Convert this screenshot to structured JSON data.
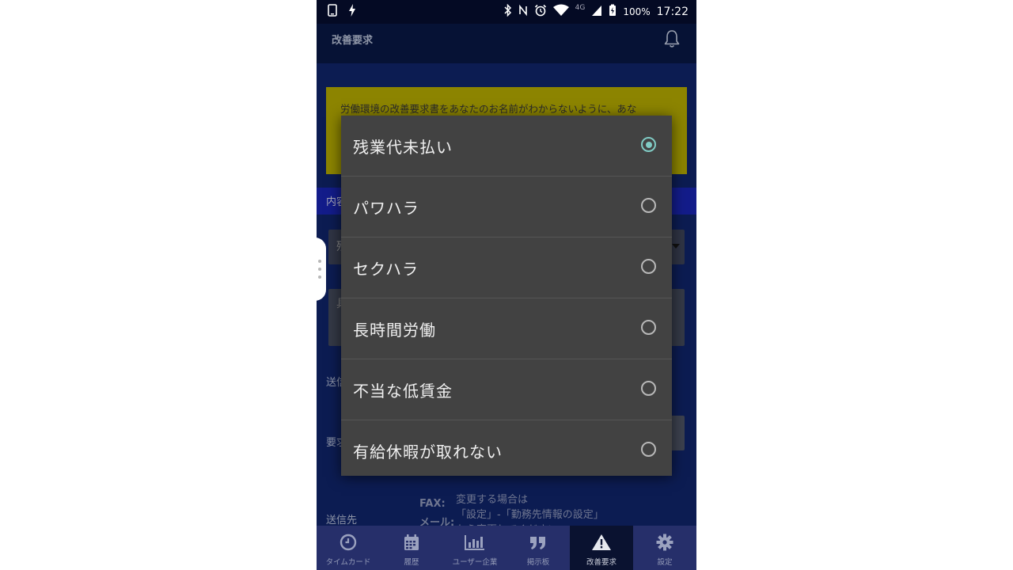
{
  "status_bar": {
    "battery": "100%",
    "time": "17:22",
    "network": "4G",
    "icons_left": [
      "phone-icon",
      "flash-icon"
    ],
    "icons_right": [
      "bluetooth-icon",
      "nfc-icon",
      "alarm-icon",
      "wifi-icon",
      "signal-icon",
      "battery-icon"
    ]
  },
  "app_bar": {
    "title": "改善要求",
    "bell_icon": "bell-icon"
  },
  "notice": {
    "text": "労働環境の改善要求書をあなたのお名前がわからないように、あな"
  },
  "form": {
    "section_label": "内容",
    "category_partial": "残",
    "detail_partial": "具",
    "send_label": "送信",
    "request_label": "要求",
    "destination_label": "送信先",
    "fax_label": "FAX:",
    "mail_label": "メール:",
    "change_note_1": "変更する場合は",
    "change_note_2": "「設定」-「勤務先情報の設定」",
    "change_note_3": "から変更してください"
  },
  "dialog": {
    "options": [
      {
        "label": "残業代未払い",
        "selected": true
      },
      {
        "label": "パワハラ",
        "selected": false
      },
      {
        "label": "セクハラ",
        "selected": false
      },
      {
        "label": "長時間労働",
        "selected": false
      },
      {
        "label": "不当な低賃金",
        "selected": false
      },
      {
        "label": "有給休暇が取れない",
        "selected": false
      }
    ]
  },
  "bottom_nav": {
    "items": [
      {
        "label": "タイムカード",
        "icon": "clock-icon",
        "active": false
      },
      {
        "label": "履歴",
        "icon": "calendar-icon",
        "active": false
      },
      {
        "label": "ユーザー企業",
        "icon": "bar-chart-icon",
        "active": false
      },
      {
        "label": "掲示板",
        "icon": "quote-icon",
        "active": false
      },
      {
        "label": "改善要求",
        "icon": "warning-icon",
        "active": true
      },
      {
        "label": "設定",
        "icon": "gear-icon",
        "active": false
      }
    ]
  },
  "colors": {
    "accent": "#80cbc4",
    "app_background": "#0c1c52",
    "notice_yellow": "#8c8400",
    "section_blue": "#131c8a",
    "dialog_background": "#424242",
    "bottom_nav": "#262f6a"
  }
}
